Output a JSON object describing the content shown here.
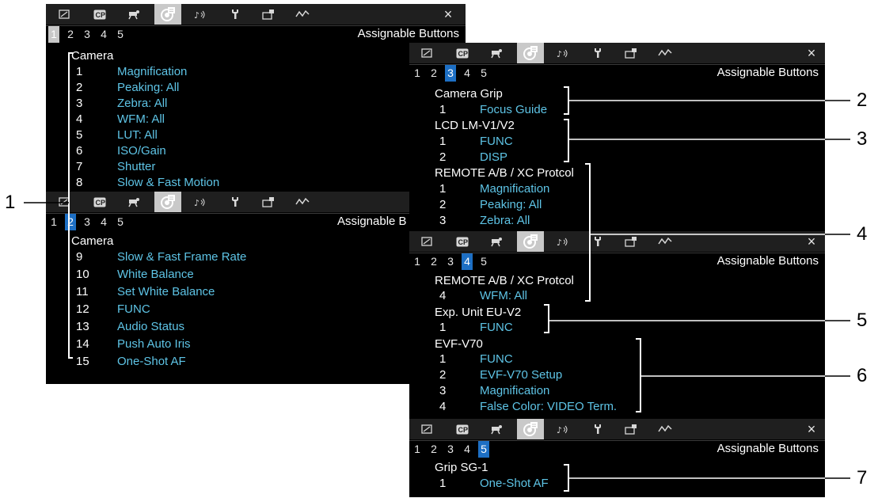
{
  "ui": {
    "panel_title": "Assignable Buttons",
    "tabs": [
      "1",
      "2",
      "3",
      "4",
      "5"
    ],
    "menu_icons": [
      "camera-frame-icon",
      "cp-icon",
      "recording-camera-icon",
      "assignable-buttons-icon",
      "audio-icon",
      "wrench-icon",
      "monitor-setup-icon",
      "waveform-icon",
      "close-icon"
    ],
    "close_glyph": "×",
    "cp_label": "CP"
  },
  "pages": {
    "p1": {
      "selected_tab": "1",
      "groups": [
        {
          "name": "Camera",
          "items": [
            {
              "n": "1",
              "f": "Magnification"
            },
            {
              "n": "2",
              "f": "Peaking: All"
            },
            {
              "n": "3",
              "f": "Zebra: All"
            },
            {
              "n": "4",
              "f": "WFM: All"
            },
            {
              "n": "5",
              "f": "LUT: All"
            },
            {
              "n": "6",
              "f": "ISO/Gain"
            },
            {
              "n": "7",
              "f": "Shutter"
            },
            {
              "n": "8",
              "f": "Slow & Fast Motion"
            }
          ]
        }
      ]
    },
    "p2": {
      "selected_tab": "2",
      "title_visible": "Assignable B",
      "groups": [
        {
          "name": "Camera",
          "items": [
            {
              "n": "9",
              "f": "Slow & Fast Frame Rate"
            },
            {
              "n": "10",
              "f": "White Balance"
            },
            {
              "n": "11",
              "f": "Set White Balance"
            },
            {
              "n": "12",
              "f": "FUNC"
            },
            {
              "n": "13",
              "f": "Audio Status"
            },
            {
              "n": "14",
              "f": "Push Auto Iris"
            },
            {
              "n": "15",
              "f": "One-Shot AF"
            }
          ]
        }
      ]
    },
    "p3": {
      "selected_tab": "3",
      "groups": [
        {
          "name": "Camera Grip",
          "items": [
            {
              "n": "1",
              "f": "Focus Guide"
            }
          ]
        },
        {
          "name": "LCD LM-V1/V2",
          "items": [
            {
              "n": "1",
              "f": "FUNC"
            },
            {
              "n": "2",
              "f": "DISP"
            }
          ]
        },
        {
          "name": "REMOTE A/B / XC Protcol",
          "items": [
            {
              "n": "1",
              "f": "Magnification"
            },
            {
              "n": "2",
              "f": "Peaking: All"
            },
            {
              "n": "3",
              "f": "Zebra: All"
            }
          ]
        }
      ]
    },
    "p4": {
      "selected_tab": "4",
      "groups": [
        {
          "name": "REMOTE A/B / XC Protcol",
          "items": [
            {
              "n": "4",
              "f": "WFM: All"
            }
          ]
        },
        {
          "name": "Exp. Unit EU-V2",
          "items": [
            {
              "n": "1",
              "f": "FUNC"
            }
          ]
        },
        {
          "name": "EVF-V70",
          "items": [
            {
              "n": "1",
              "f": "FUNC"
            },
            {
              "n": "2",
              "f": "EVF-V70 Setup"
            },
            {
              "n": "3",
              "f": "Magnification"
            },
            {
              "n": "4",
              "f": "False Color: VIDEO Term."
            }
          ]
        }
      ]
    },
    "p5": {
      "selected_tab": "5",
      "groups": [
        {
          "name": "Grip SG-1",
          "items": [
            {
              "n": "1",
              "f": "One-Shot AF"
            }
          ]
        }
      ]
    }
  },
  "callouts": [
    "1",
    "2",
    "3",
    "4",
    "5",
    "6",
    "7"
  ]
}
